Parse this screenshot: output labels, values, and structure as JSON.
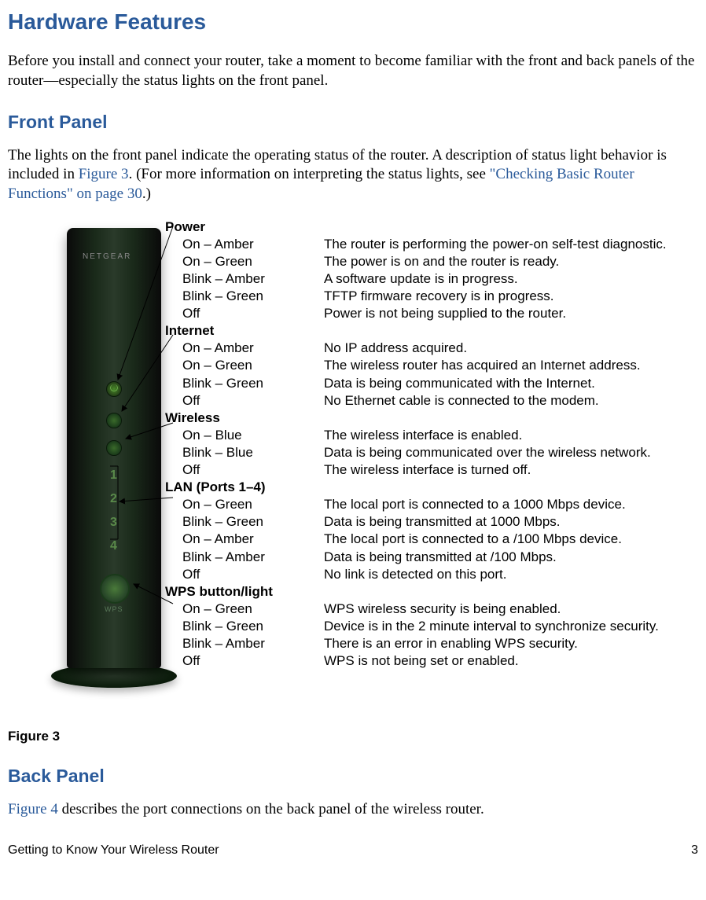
{
  "headings": {
    "h1": "Hardware Features",
    "front_panel": "Front Panel",
    "back_panel": "Back Panel"
  },
  "intro_para": "Before you install and connect your router, take a moment to become familiar with the front and back panels of the router—especially the status lights on the front panel.",
  "front_para_pre": "The lights on the front panel indicate the operating status of the router. A description of status light behavior is included in ",
  "front_para_link1": "Figure 3",
  "front_para_mid": ". (For more information on interpreting the status lights, see ",
  "front_para_link2": "\"Checking Basic Router Functions\" on page 30",
  "front_para_post": ".)",
  "router_brand": "NETGEAR",
  "wps_text": "WPS",
  "groups": [
    {
      "name": "Power",
      "rows": [
        {
          "state": "On – Amber",
          "desc": "The router is performing the power-on self-test diagnostic."
        },
        {
          "state": "On – Green",
          "desc": "The power is on and the router is ready."
        },
        {
          "state": "Blink – Amber",
          "desc": "A software update is in progress."
        },
        {
          "state": "Blink – Green",
          "desc": "TFTP firmware recovery is in progress."
        },
        {
          "state": "Off",
          "desc": "Power is not being supplied to the router."
        }
      ]
    },
    {
      "name": "Internet",
      "rows": [
        {
          "state": "On – Amber",
          "desc": "No IP address acquired."
        },
        {
          "state": "On – Green",
          "desc": "The wireless router has acquired an Internet address."
        },
        {
          "state": "Blink – Green",
          "desc": "Data is being communicated with the Internet."
        },
        {
          "state": "Off",
          "desc": "No Ethernet cable is connected to the modem."
        }
      ]
    },
    {
      "name": "Wireless",
      "rows": [
        {
          "state": "On – Blue",
          "desc": "The wireless interface is enabled."
        },
        {
          "state": "Blink – Blue",
          "desc": "Data is being communicated over the wireless network."
        },
        {
          "state": "Off",
          "desc": "The wireless interface is turned off."
        }
      ]
    },
    {
      "name": "LAN (Ports 1–4)",
      "rows": [
        {
          "state": "On – Green",
          "desc": "The local port is connected to a 1000 Mbps device."
        },
        {
          "state": "Blink – Green",
          "desc": "Data is being transmitted at 1000 Mbps."
        },
        {
          "state": "On – Amber",
          "desc": "The local port is connected to a /100 Mbps device."
        },
        {
          "state": "Blink – Amber",
          "desc": "Data is being transmitted at /100 Mbps."
        },
        {
          "state": "Off",
          "desc": "No link is detected on this port."
        }
      ]
    },
    {
      "name": "WPS button/light",
      "rows": [
        {
          "state": "On – Green",
          "desc": "WPS wireless security is being enabled."
        },
        {
          "state": "Blink – Green",
          "desc": "Device is in the 2 minute interval to synchronize security."
        },
        {
          "state": "Blink – Amber",
          "desc": "There is an error in enabling WPS security."
        },
        {
          "state": "Off",
          "desc": "WPS is not being set or enabled."
        }
      ]
    }
  ],
  "figure_caption": "Figure 3",
  "back_para_link": "Figure 4",
  "back_para_post": " describes the port connections on the back panel of the wireless router.",
  "footer_left": "Getting to Know Your Wireless Router",
  "footer_right": "3",
  "port_nums": {
    "p1": "1",
    "p2": "2",
    "p3": "3",
    "p4": "4"
  }
}
